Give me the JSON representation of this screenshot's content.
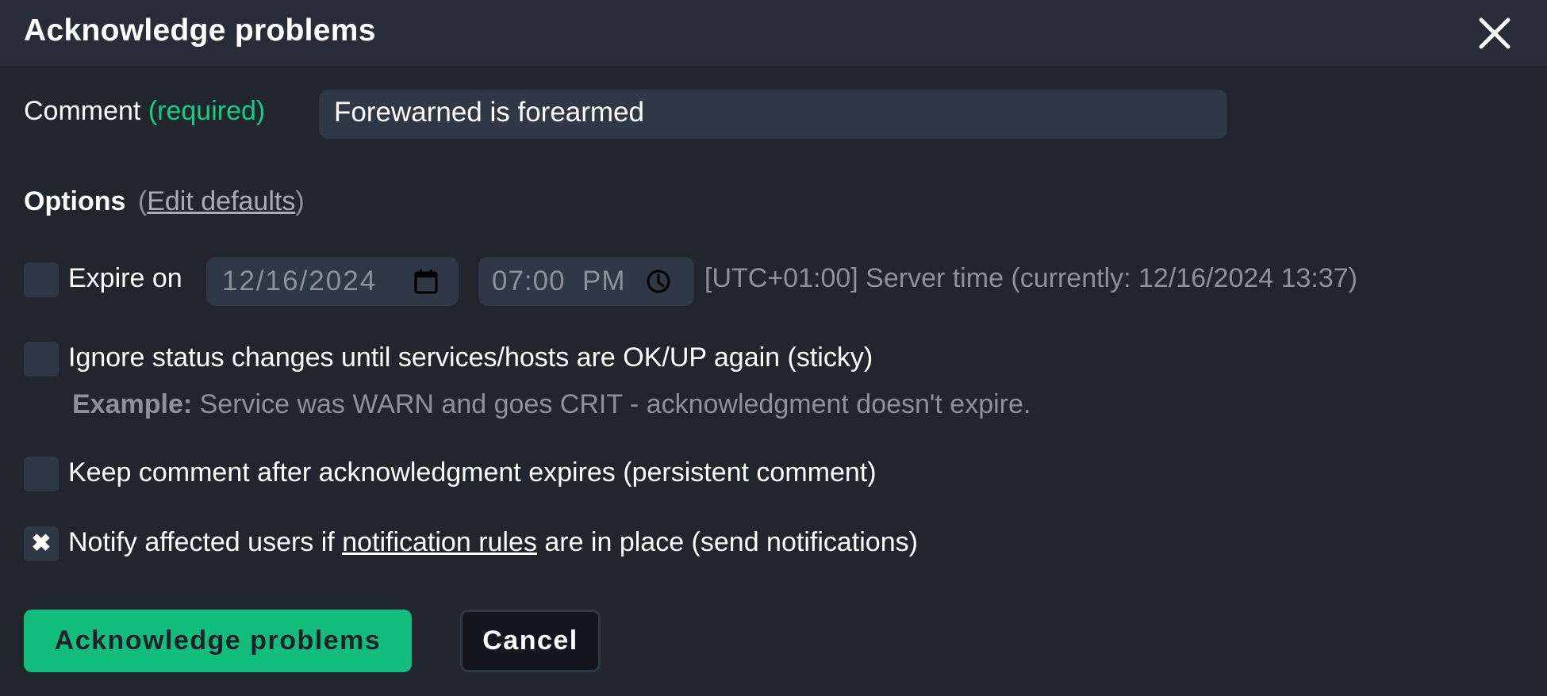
{
  "dialog": {
    "title": "Acknowledge problems",
    "close_icon": "close-icon"
  },
  "comment": {
    "label": "Comment",
    "required_label": "(required)",
    "value": "Forewarned is forearmed"
  },
  "options": {
    "heading": "Options",
    "paren_open": "(",
    "edit_defaults_link": "Edit defaults",
    "paren_close": ")"
  },
  "expire": {
    "checked": false,
    "label": "Expire on",
    "date_value": "12/16/2024",
    "date_icon": "calendar-icon",
    "time_value": "07:00  PM",
    "time_icon": "clock-icon",
    "server_time_note": "[UTC+01:00] Server time (currently: 12/16/2024 13:37)"
  },
  "sticky": {
    "checked": false,
    "label": "Ignore status changes until services/hosts are OK/UP again (sticky)",
    "example_label": "Example:",
    "example_text": " Service was WARN and goes CRIT - acknowledgment doesn't expire."
  },
  "persistent": {
    "checked": false,
    "label": "Keep comment after acknowledgment expires (persistent comment)"
  },
  "notify": {
    "checked": true,
    "check_glyph": "✖",
    "label_before": "Notify affected users if ",
    "link_text": "notification rules",
    "label_after": " are in place (send notifications)"
  },
  "buttons": {
    "acknowledge": "Acknowledge problems",
    "cancel": "Cancel"
  },
  "colors": {
    "accent_green": "#13bd7b",
    "required_green": "#15cc87",
    "background": "#21262e",
    "header": "#272d38",
    "field": "#2f3845"
  }
}
